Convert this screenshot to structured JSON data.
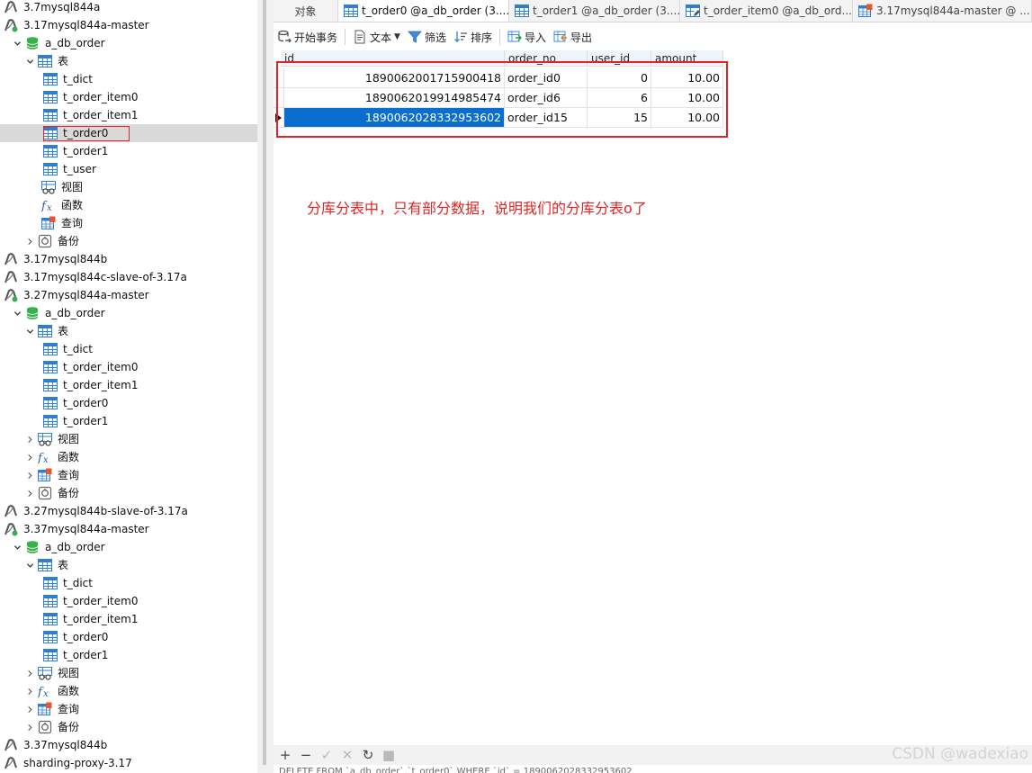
{
  "tree": [
    {
      "label": "3.7mysql844a",
      "type": "conn-off",
      "depth": 0,
      "chev": "none"
    },
    {
      "label": "3.17mysql844a-master",
      "type": "conn-on",
      "depth": 0,
      "chev": "down"
    },
    {
      "label": "a_db_order",
      "type": "db",
      "depth": 1,
      "chev": "down"
    },
    {
      "label": "表",
      "type": "tables",
      "depth": 2,
      "chev": "down"
    },
    {
      "label": "t_dict",
      "type": "table",
      "depth": 3,
      "chev": "none"
    },
    {
      "label": "t_order_item0",
      "type": "table",
      "depth": 3,
      "chev": "none"
    },
    {
      "label": "t_order_item1",
      "type": "table",
      "depth": 3,
      "chev": "none"
    },
    {
      "label": "t_order0",
      "type": "table",
      "depth": 3,
      "chev": "none",
      "selected": true
    },
    {
      "label": "t_order1",
      "type": "table",
      "depth": 3,
      "chev": "none"
    },
    {
      "label": "t_user",
      "type": "table",
      "depth": 3,
      "chev": "none"
    },
    {
      "label": "视图",
      "type": "view",
      "depth": 2,
      "chev": "none"
    },
    {
      "label": "函数",
      "type": "func",
      "depth": 2,
      "chev": "none"
    },
    {
      "label": "查询",
      "type": "query",
      "depth": 2,
      "chev": "none"
    },
    {
      "label": "备份",
      "type": "backup",
      "depth": 2,
      "chev": "right"
    },
    {
      "label": "3.17mysql844b",
      "type": "conn-off",
      "depth": 0,
      "chev": "none"
    },
    {
      "label": "3.17mysql844c-slave-of-3.17a",
      "type": "conn-off",
      "depth": 0,
      "chev": "none"
    },
    {
      "label": "3.27mysql844a-master",
      "type": "conn-on",
      "depth": 0,
      "chev": "down"
    },
    {
      "label": "a_db_order",
      "type": "db",
      "depth": 1,
      "chev": "down"
    },
    {
      "label": "表",
      "type": "tables",
      "depth": 2,
      "chev": "down"
    },
    {
      "label": "t_dict",
      "type": "table",
      "depth": 3,
      "chev": "none"
    },
    {
      "label": "t_order_item0",
      "type": "table",
      "depth": 3,
      "chev": "none"
    },
    {
      "label": "t_order_item1",
      "type": "table",
      "depth": 3,
      "chev": "none"
    },
    {
      "label": "t_order0",
      "type": "table",
      "depth": 3,
      "chev": "none"
    },
    {
      "label": "t_order1",
      "type": "table",
      "depth": 3,
      "chev": "none"
    },
    {
      "label": "视图",
      "type": "view",
      "depth": 2,
      "chev": "right"
    },
    {
      "label": "函数",
      "type": "func",
      "depth": 2,
      "chev": "right"
    },
    {
      "label": "查询",
      "type": "query",
      "depth": 2,
      "chev": "right"
    },
    {
      "label": "备份",
      "type": "backup",
      "depth": 2,
      "chev": "right"
    },
    {
      "label": "3.27mysql844b-slave-of-3.17a",
      "type": "conn-off",
      "depth": 0,
      "chev": "none"
    },
    {
      "label": "3.37mysql844a-master",
      "type": "conn-on",
      "depth": 0,
      "chev": "down"
    },
    {
      "label": "a_db_order",
      "type": "db",
      "depth": 1,
      "chev": "down"
    },
    {
      "label": "表",
      "type": "tables",
      "depth": 2,
      "chev": "down"
    },
    {
      "label": "t_dict",
      "type": "table",
      "depth": 3,
      "chev": "none"
    },
    {
      "label": "t_order_item0",
      "type": "table",
      "depth": 3,
      "chev": "none"
    },
    {
      "label": "t_order_item1",
      "type": "table",
      "depth": 3,
      "chev": "none"
    },
    {
      "label": "t_order0",
      "type": "table",
      "depth": 3,
      "chev": "none"
    },
    {
      "label": "t_order1",
      "type": "table",
      "depth": 3,
      "chev": "none"
    },
    {
      "label": "视图",
      "type": "view",
      "depth": 2,
      "chev": "right"
    },
    {
      "label": "函数",
      "type": "func",
      "depth": 2,
      "chev": "right"
    },
    {
      "label": "查询",
      "type": "query",
      "depth": 2,
      "chev": "right"
    },
    {
      "label": "备份",
      "type": "backup",
      "depth": 2,
      "chev": "right"
    },
    {
      "label": "3.37mysql844b",
      "type": "conn-off",
      "depth": 0,
      "chev": "none"
    },
    {
      "label": "sharding-proxy-3.17",
      "type": "conn-off",
      "depth": 0,
      "chev": "none"
    }
  ],
  "tabs": [
    {
      "label": "对象",
      "icon": "none",
      "active": false
    },
    {
      "label": "t_order0 @a_db_order (3....",
      "icon": "table",
      "active": true
    },
    {
      "label": "t_order1 @a_db_order (3....",
      "icon": "table",
      "active": false
    },
    {
      "label": "t_order_item0 @a_db_ord...",
      "icon": "table-edit",
      "active": false
    },
    {
      "label": "3.17mysql844a-master @ ...",
      "icon": "query",
      "active": false
    }
  ],
  "toolbar": {
    "begin_tx": "开始事务",
    "text": "文本",
    "filter": "筛选",
    "sort": "排序",
    "import": "导入",
    "export": "导出"
  },
  "grid": {
    "columns": [
      "id",
      "order_no",
      "user_id",
      "amount"
    ],
    "rows": [
      [
        "1890062001715900418",
        "order_id0",
        "0",
        "10.00"
      ],
      [
        "1890062019914985474",
        "order_id6",
        "6",
        "10.00"
      ],
      [
        "1890062028332953602",
        "order_id15",
        "15",
        "10.00"
      ]
    ],
    "selected_row": 2
  },
  "annotation": "分库分表中，只有部分数据，说明我们的分库分表o了",
  "sql_preview": "DELETE FROM `a_db_order`.`t_order0` WHERE `id` = 1890062028332953602",
  "watermark": "CSDN @wadexiao"
}
